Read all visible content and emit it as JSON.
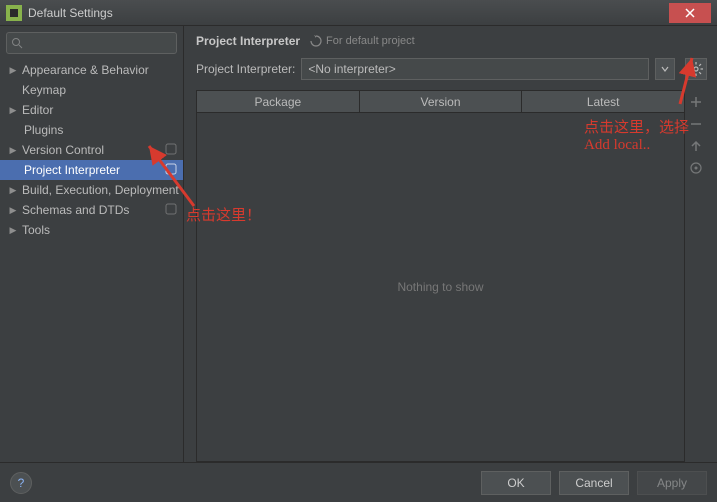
{
  "window": {
    "title": "Default Settings"
  },
  "search": {
    "placeholder": ""
  },
  "sidebar": {
    "items": [
      {
        "label": "Appearance & Behavior",
        "expandable": true,
        "child": false
      },
      {
        "label": "Keymap",
        "expandable": false,
        "child": false
      },
      {
        "label": "Editor",
        "expandable": true,
        "child": false
      },
      {
        "label": "Plugins",
        "expandable": false,
        "child": true
      },
      {
        "label": "Version Control",
        "expandable": true,
        "child": false,
        "badge": true
      },
      {
        "label": "Project Interpreter",
        "expandable": false,
        "child": true,
        "selected": true,
        "badge": true
      },
      {
        "label": "Build, Execution, Deployment",
        "expandable": true,
        "child": false
      },
      {
        "label": "Schemas and DTDs",
        "expandable": true,
        "child": false,
        "badge": true
      },
      {
        "label": "Tools",
        "expandable": true,
        "child": false
      }
    ]
  },
  "main": {
    "title": "Project Interpreter",
    "subtitle": "For default project",
    "interpreter_label": "Project Interpreter:",
    "interpreter_value": "<No interpreter>",
    "columns": [
      "Package",
      "Version",
      "Latest"
    ],
    "empty_text": "Nothing to show"
  },
  "footer": {
    "help": "?",
    "ok": "OK",
    "cancel": "Cancel",
    "apply": "Apply"
  },
  "annotations": {
    "left": "点击这里！",
    "right": "点击这里，选择\nAdd local.."
  },
  "colors": {
    "bg": "#3c3f41",
    "selection": "#4b6eaf",
    "annotation": "#d73a2e"
  }
}
